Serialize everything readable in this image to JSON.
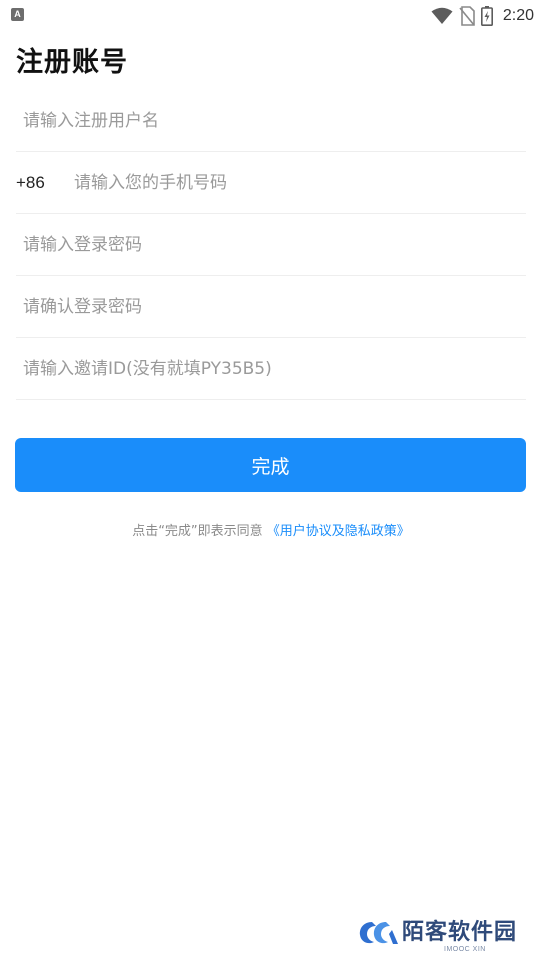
{
  "status_bar": {
    "notification_letter": "A",
    "time": "2:20",
    "icons": [
      "wifi-icon",
      "no-sim-icon",
      "battery-charging-icon"
    ]
  },
  "page": {
    "title": "注册账号"
  },
  "form": {
    "username_placeholder": "请输入注册用户名",
    "country_code": "+86",
    "phone_placeholder": "请输入您的手机号码",
    "password_placeholder": "请输入登录密码",
    "confirm_password_placeholder": "请确认登录密码",
    "invite_placeholder": "请输入邀请ID(没有就填PY35B5)"
  },
  "submit": {
    "label": "完成"
  },
  "agreement": {
    "prefix": "点击“完成”即表示同意 ",
    "link_text": "《用户协议及隐私政策》"
  },
  "watermark": {
    "title": "陌客软件园",
    "subtitle": "IMOOC XIN"
  },
  "colors": {
    "accent": "#1a8dfa",
    "placeholder": "#9a9a9a",
    "divider": "#eeeeee"
  }
}
